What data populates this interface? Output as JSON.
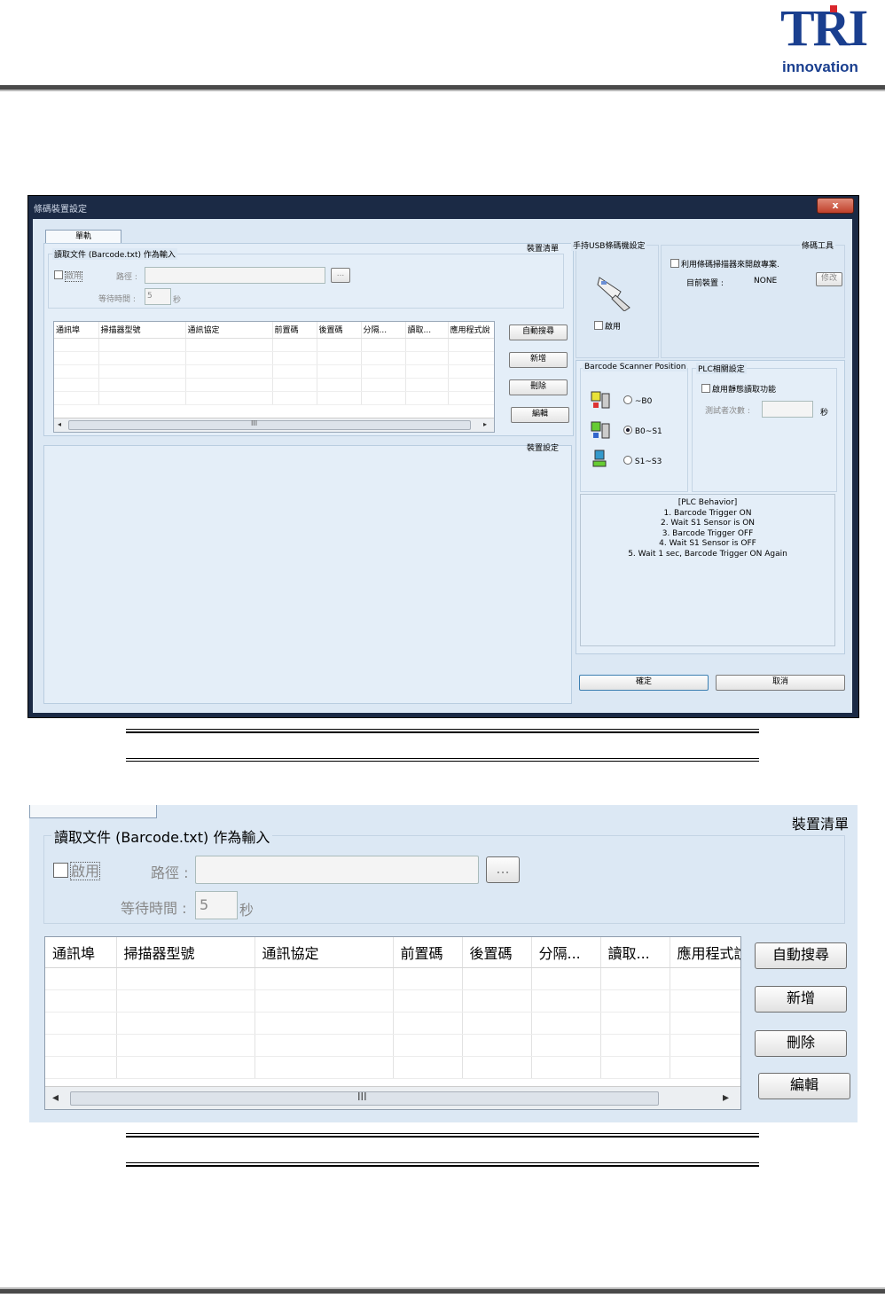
{
  "logo": {
    "tri": "TRI",
    "sub": "innovation"
  },
  "dialog": {
    "title": "條碼裝置設定",
    "close": "x",
    "tab": "單軌",
    "device_list_label": "裝置清單",
    "device_settings_label": "裝置設定",
    "file_group": {
      "label": "讀取文件 (Barcode.txt) 作為輸入",
      "enable": "啟用",
      "path_label": "路徑 :",
      "browse": "...",
      "wait_label": "等待時間 :",
      "wait_value": "5",
      "wait_unit": "秒"
    },
    "table": {
      "headers": [
        "通訊埠",
        "掃描器型號",
        "通訊協定",
        "前置碼",
        "後置碼",
        "分隔...",
        "讀取...",
        "應用程式說"
      ]
    },
    "buttons": {
      "auto_search": "自動搜尋",
      "add": "新增",
      "delete": "刪除",
      "edit": "編輯",
      "ok": "確定",
      "cancel": "取消"
    },
    "usb_group": {
      "label": "手持USB條碼機設定",
      "enable": "啟用"
    },
    "tools_group": {
      "label": "條碼工具",
      "open_project": "利用條碼掃描器來開啟專案.",
      "current_device_label": "目前裝置 :",
      "current_device_value": "NONE",
      "modify": "修改"
    },
    "position_group": {
      "label": "Barcode Scanner Position",
      "options": [
        "~B0",
        "B0~S1",
        "S1~S3"
      ],
      "selected": "B0~S1"
    },
    "plc_group": {
      "label": "PLC相關設定",
      "enable_static": "啟用靜態讀取功能",
      "test_count_label": "測試者次數 :",
      "test_unit": "秒"
    },
    "plc_behavior": [
      "[PLC Behavior]",
      "1. Barcode Trigger ON",
      "2. Wait S1 Sensor is ON",
      "3. Barcode Trigger OFF",
      "4. Wait S1 Sensor is OFF",
      "5. Wait 1 sec, Barcode Trigger ON Again"
    ]
  },
  "zoom": {
    "device_list_label": "裝置清單",
    "file_group_label": "讀取文件 (Barcode.txt) 作為輸入",
    "enable": "啟用",
    "path_label": "路徑 :",
    "browse": "...",
    "wait_label": "等待時間 :",
    "wait_value": "5",
    "wait_unit": "秒",
    "headers": [
      "通訊埠",
      "掃描器型號",
      "通訊協定",
      "前置碼",
      "後置碼",
      "分隔...",
      "讀取...",
      "應用程式說"
    ],
    "buttons": {
      "auto_search": "自動搜尋",
      "add": "新增",
      "delete": "刪除",
      "edit": "編輯"
    },
    "scroll_grip": "III"
  },
  "colors": {
    "brand": "#1a3f8f",
    "accent": "#d9262c",
    "dialog_bg": "#dce8f4",
    "title_bar": "#1b2a45"
  }
}
